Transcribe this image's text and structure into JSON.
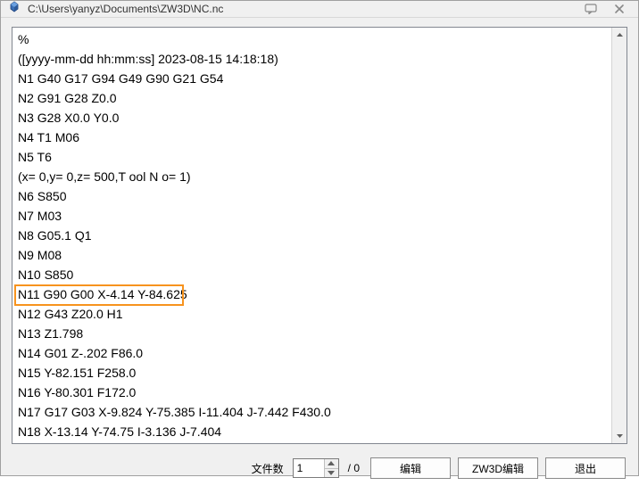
{
  "window": {
    "title": "C:\\Users\\yanyz\\Documents\\ZW3D\\NC.nc"
  },
  "nc_lines": [
    "%",
    "([yyyy-mm-dd hh:mm:ss] 2023-08-15 14:18:18)",
    "N1 G40 G17 G94 G49 G90 G21 G54",
    "N2 G91 G28 Z0.0",
    "N3 G28 X0.0 Y0.0",
    "N4 T1 M06",
    "N5 T6",
    "(x= 0,y= 0,z= 500,T ool N o= 1)",
    "N6 S850",
    "N7 M03",
    "N8 G05.1 Q1",
    "N9 M08",
    "N10 S850",
    "N11 G90 G00 X-4.14 Y-84.625",
    "N12 G43 Z20.0 H1",
    "N13 Z1.798",
    "N14 G01 Z-.202 F86.0",
    "N15 Y-82.151 F258.0",
    "N16 Y-80.301 F172.0",
    "N17 G17 G03 X-9.824 Y-75.385 I-11.404 J-7.442 F430.0",
    "N18 X-13.14 Y-74.75 I-3.136 J-7.404"
  ],
  "bottom": {
    "file_count_label": "文件数",
    "file_count_value": "1",
    "total_divider": "/ 0",
    "edit_label": "编辑",
    "zw_edit_label": "ZW3D编辑",
    "exit_label": "退出"
  }
}
